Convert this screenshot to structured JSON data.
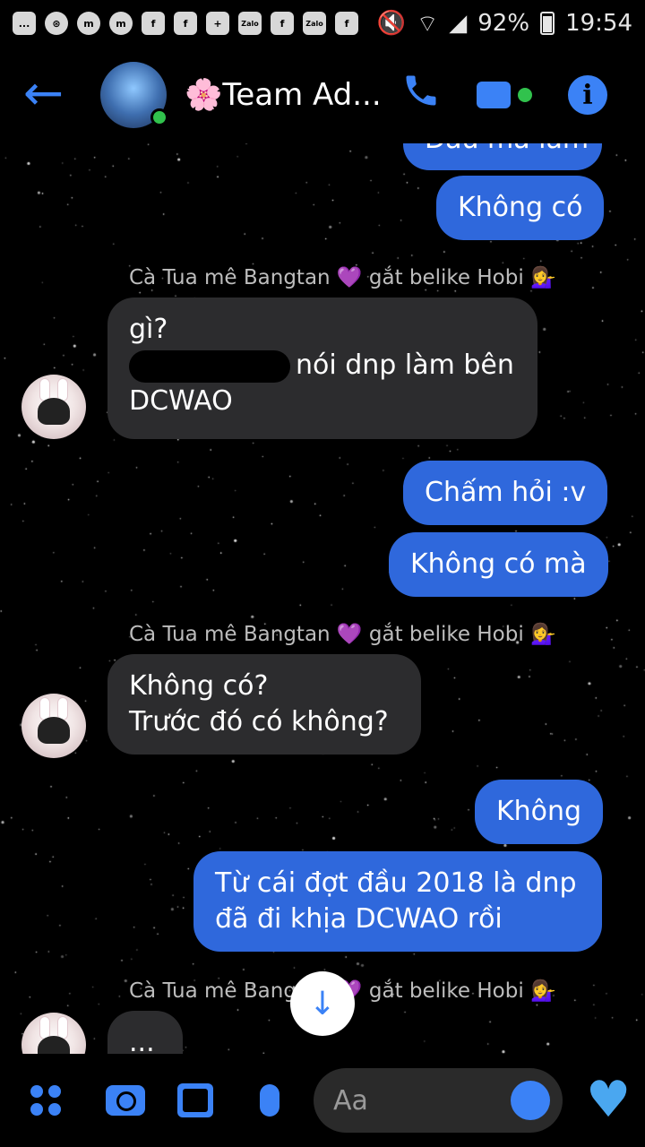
{
  "status_bar": {
    "battery": "92%",
    "time": "19:54",
    "notification_icons": [
      "...",
      "⊛",
      "m",
      "m",
      "f",
      "f",
      "+",
      "Zalo",
      "f",
      "Zalo",
      "f"
    ]
  },
  "header": {
    "title": "🌸Team Ad...",
    "back_label": "←"
  },
  "messages": {
    "partial_top": "Dầu mà làm",
    "m1": "Không có",
    "sender_name": "Cà Tua mê Bangtan 💜 gắt belike Hobi 💁‍♀️",
    "in1_line1": "gì?",
    "in1_line2": "nói dnp làm bên",
    "in1_line3": "DCWAO",
    "m2": "Chấm hỏi :v",
    "m3": "Không có mà",
    "in2_line1": "Không có?",
    "in2_line2": "Trước đó có không?",
    "m4": "Không",
    "m5_line1": "Từ cái đợt đầu 2018 là dnp",
    "m5_line2": "đã đi khịa DCWAO rồi",
    "typing": "..."
  },
  "composer": {
    "placeholder": "Aa"
  },
  "colors": {
    "accent": "#3b82f6",
    "outgoing_bubble": "#2f68dc",
    "incoming_bubble": "#2c2c2e",
    "online": "#31c24d"
  }
}
